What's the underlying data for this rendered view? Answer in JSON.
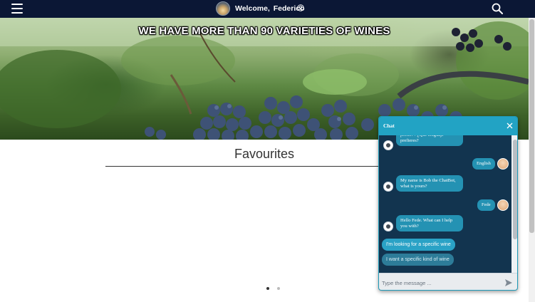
{
  "header": {
    "welcome_label": "Welcome,",
    "user_name": "Federico",
    "icons": {
      "menu": "hamburger-icon",
      "profile": "user-circle-icon",
      "search": "search-icon",
      "logo": "sunset-logo"
    }
  },
  "hero": {
    "title": "WE HAVE MORE THAN 90 VARIETIES OF WINES"
  },
  "favourites": {
    "title": "Favourites",
    "carousel_pages": 2,
    "active_page": 1
  },
  "chat": {
    "title": "Chat",
    "messages": [
      {
        "sender": "bot",
        "text": "prefer? / ¿Qué lenguaje prefieres?"
      },
      {
        "sender": "user",
        "text": "English"
      },
      {
        "sender": "bot",
        "text": "My name is Bob the ChatBot, what is yours?"
      },
      {
        "sender": "user",
        "text": "Fede"
      },
      {
        "sender": "bot",
        "text": "Hello Fede. What can I help you with?"
      }
    ],
    "choices": [
      "I'm looking for a specific wine",
      "I want a specific kind of wine"
    ],
    "input_placeholder": "Type the message ..."
  },
  "colors": {
    "topbar": "#0b1735",
    "chat_header": "#22a3c4",
    "chat_body": "#12344f",
    "bubble": "#2492b3"
  }
}
